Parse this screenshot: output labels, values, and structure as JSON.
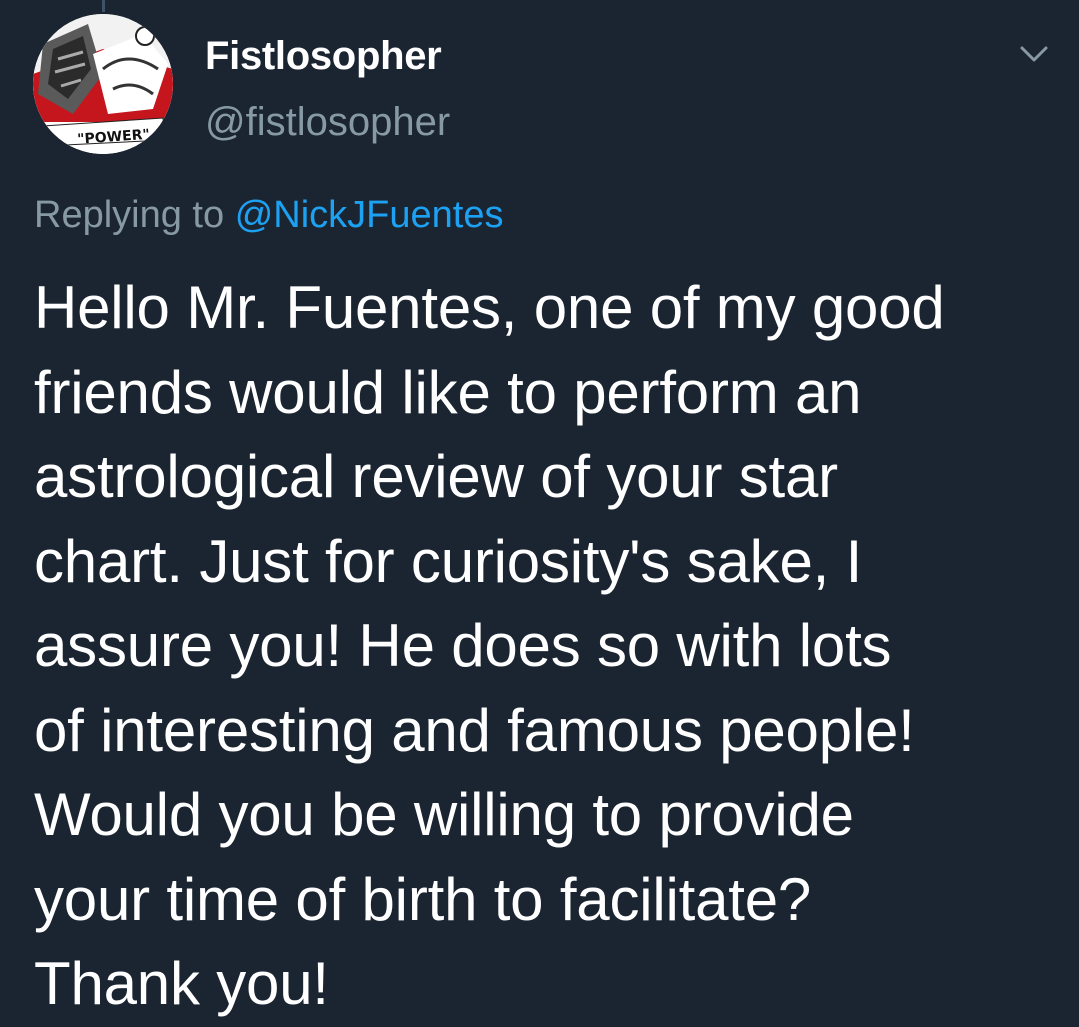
{
  "author": {
    "display_name": "Fistlosopher",
    "handle": "@fistlosopher",
    "avatar_caption": "\"POWER\""
  },
  "reply": {
    "prefix": "Replying to",
    "mention": "@NickJFuentes"
  },
  "tweet": {
    "lines": [
      "Hello Mr. Fuentes, one of my good",
      "friends would like to perform an",
      "astrological review of your star",
      "chart. Just for curiosity's sake, I",
      "assure you! He does so with lots",
      "of interesting and famous people!",
      "Would you be willing to provide",
      "your time of birth to facilitate?",
      "Thank you!"
    ]
  },
  "icons": {
    "menu": "chevron-down-icon"
  },
  "colors": {
    "background": "#1b2531",
    "primary_text": "#ffffff",
    "secondary_text": "#8899a6",
    "link": "#1da1f2"
  }
}
